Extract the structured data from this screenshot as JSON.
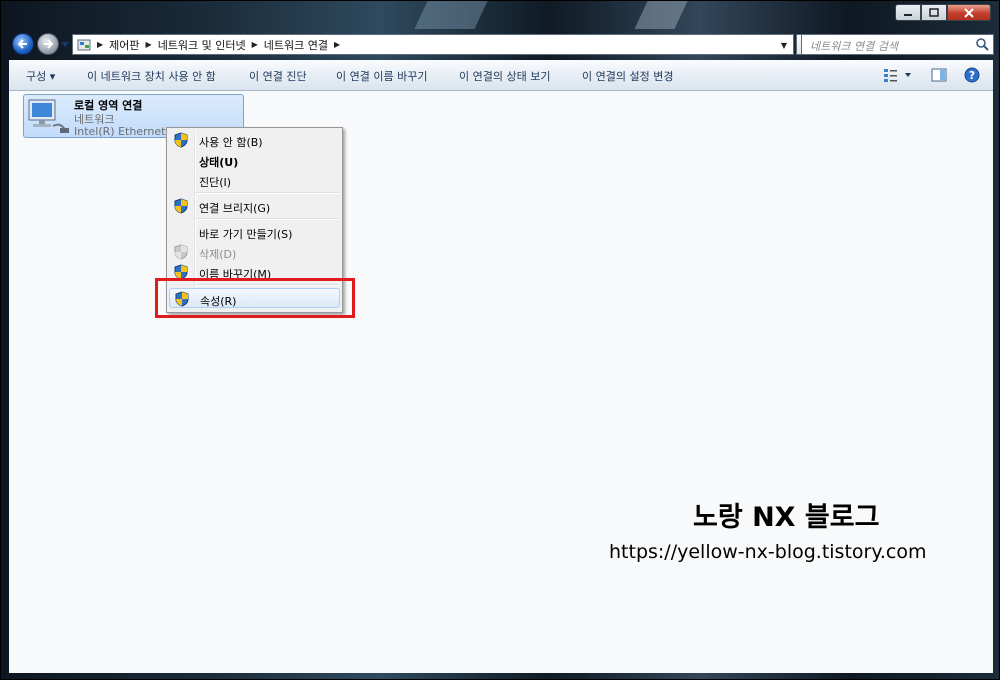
{
  "window": {
    "caption_buttons": [
      "minimize",
      "maximize",
      "close"
    ]
  },
  "navbar": {
    "breadcrumb": [
      "제어판",
      "네트워크 및 인터넷",
      "네트워크 연결"
    ],
    "search_placeholder": "네트워크 연결 검색"
  },
  "toolbar": {
    "organize": "구성 ▾",
    "disable": "이 네트워크 장치 사용 안 함",
    "diagnose": "이 연결 진단",
    "rename": "이 연결 이름 바꾸기",
    "status": "이 연결의 상태 보기",
    "settings": "이 연결의 설정 변경"
  },
  "connection": {
    "name": "로컬 영역 연결",
    "type": "네트워크",
    "adapter": "Intel(R) Ethernet Co..."
  },
  "context_menu": {
    "items": [
      {
        "label": "사용 안 함(B)",
        "shield": true,
        "bold": false,
        "disabled": false
      },
      {
        "label": "상태(U)",
        "shield": false,
        "bold": true,
        "disabled": false
      },
      {
        "label": "진단(I)",
        "shield": false,
        "bold": false,
        "disabled": false
      },
      {
        "label": "연결 브리지(G)",
        "shield": true,
        "bold": false,
        "disabled": false
      },
      {
        "label": "바로 가기 만들기(S)",
        "shield": false,
        "bold": false,
        "disabled": false
      },
      {
        "label": "삭제(D)",
        "shield": true,
        "bold": false,
        "disabled": true
      },
      {
        "label": "이름 바꾸기(M)",
        "shield": true,
        "bold": false,
        "disabled": false
      },
      {
        "label": "속성(R)",
        "shield": true,
        "bold": false,
        "disabled": false,
        "highlighted": true
      }
    ]
  },
  "watermark": {
    "title": "노랑 NX 블로그",
    "url": "https://yellow-nx-blog.tistory.com"
  },
  "colors": {
    "highlight_box": "#e01b1b",
    "toolbar_text": "#1e395b",
    "selection": "#c1dcfc"
  }
}
